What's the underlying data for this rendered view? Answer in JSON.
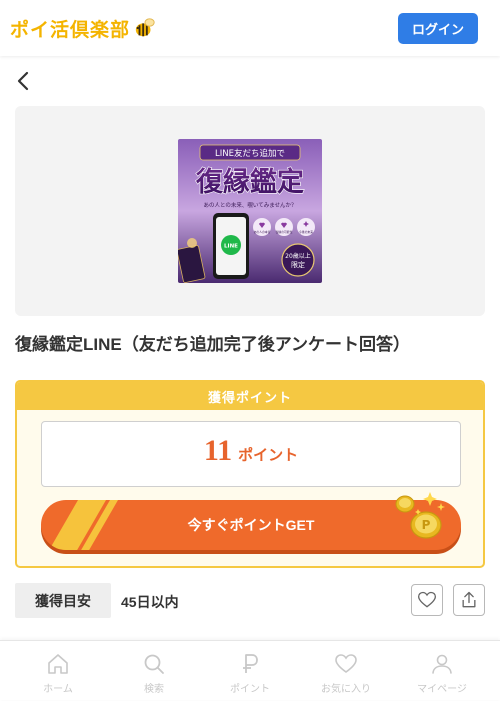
{
  "header": {
    "logo_text": "ポイ活倶楽部",
    "login_label": "ログイン"
  },
  "banner": {
    "top_text": "LINE友だち追加で",
    "main_text": "復縁鑑定",
    "sub_text": "あの人との未来、覗いてみませんか？",
    "circles": [
      "あの人の本音",
      "復縁の可能性",
      "今後の未来"
    ],
    "badge_line1": "20歳以上",
    "badge_line2": "限定",
    "phone_logo": "LINE"
  },
  "offer": {
    "title": "復縁鑑定LINE（友だち追加完了後アンケート回答）"
  },
  "points": {
    "header": "獲得ポイント",
    "value": "11",
    "unit": "ポイント",
    "button_label": "今すぐポイントGET"
  },
  "estimate": {
    "label": "獲得目安",
    "value": "45日以内"
  },
  "tabs": [
    {
      "label": "ホーム",
      "icon": "home-icon"
    },
    {
      "label": "検索",
      "icon": "search-icon"
    },
    {
      "label": "ポイント",
      "icon": "point-icon"
    },
    {
      "label": "お気に入り",
      "icon": "heart-icon"
    },
    {
      "label": "マイページ",
      "icon": "user-icon"
    }
  ],
  "colors": {
    "logo": "#f4b400",
    "login": "#2f7de6",
    "accent": "#ef6a2b",
    "point_header": "#f5c842",
    "point_value": "#e7642d",
    "tab_inactive": "#c8c8c8"
  }
}
